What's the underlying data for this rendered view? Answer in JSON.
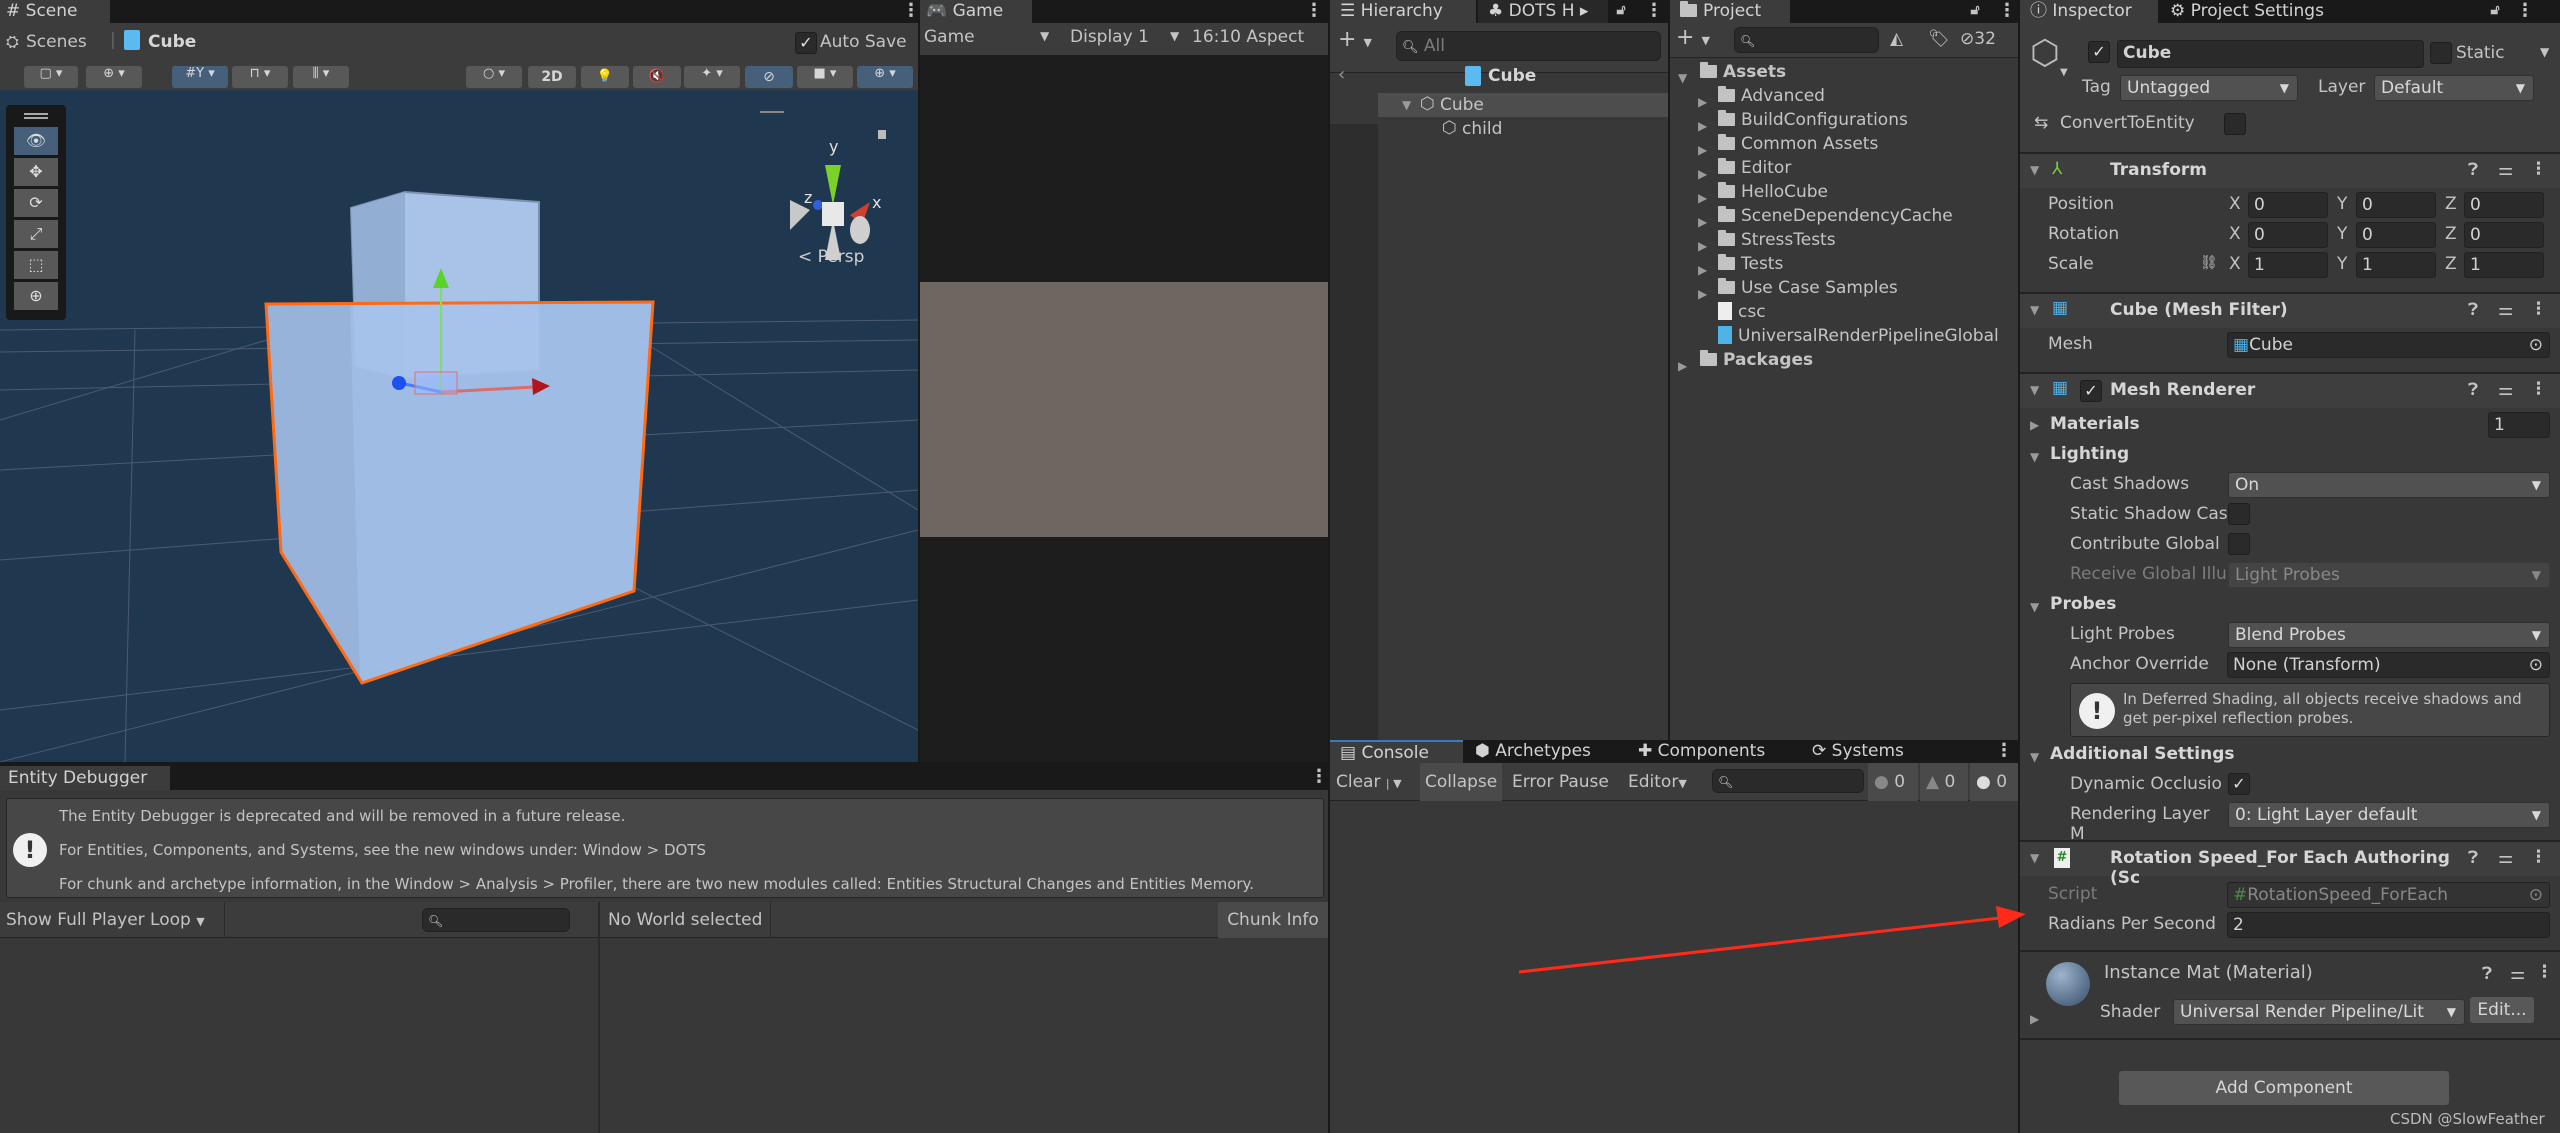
{
  "scene": {
    "tab": "Scene",
    "breadcrumb": [
      "Scenes",
      "Cube"
    ],
    "auto_save_label": "Auto Save",
    "auto_save_checked": true,
    "btn_2d": "2D",
    "persp_label": "Persp",
    "gizmo_axes": [
      "y",
      "z",
      "x"
    ],
    "tools": [
      "view-tool-icon",
      "move-tool-icon",
      "rotate-tool-icon",
      "scale-tool-icon",
      "rect-tool-icon",
      "transform-tool-icon"
    ],
    "sky_color": "#203750",
    "selection_color": "#ff6a13"
  },
  "game": {
    "tab": "Game",
    "mode": "Game",
    "display": "Display 1",
    "aspect": "16:10 Aspect",
    "viewport_color": "#6e6660"
  },
  "hierarchy": {
    "tabs": [
      "Hierarchy",
      "DOTS H"
    ],
    "search_placeholder": "All",
    "breadcrumb": "Cube",
    "items": [
      {
        "label": "Cube",
        "expanded": true,
        "selected": true
      },
      {
        "label": "child"
      }
    ]
  },
  "project": {
    "tab": "Project",
    "hidden_count": "32",
    "assets_label": "Assets",
    "folders": [
      "Advanced",
      "BuildConfigurations",
      "Common Assets",
      "Editor",
      "HelloCube",
      "SceneDependencyCache",
      "StressTests",
      "Tests",
      "Use Case Samples"
    ],
    "files": [
      "csc",
      "UniversalRenderPipelineGlobal"
    ],
    "packages_label": "Packages"
  },
  "inspector": {
    "tabs": [
      "Inspector",
      "Project Settings"
    ],
    "object_name": "Cube",
    "active": true,
    "static_label": "Static",
    "tag_label": "Tag",
    "tag_value": "Untagged",
    "layer_label": "Layer",
    "layer_value": "Default",
    "convert_label": "ConvertToEntity",
    "transform": {
      "title": "Transform",
      "rows": [
        {
          "label": "Position",
          "x": "0",
          "y": "0",
          "z": "0"
        },
        {
          "label": "Rotation",
          "x": "0",
          "y": "0",
          "z": "0"
        },
        {
          "label": "Scale",
          "x": "1",
          "y": "1",
          "z": "1"
        }
      ],
      "axes": [
        "X",
        "Y",
        "Z"
      ]
    },
    "mesh_filter": {
      "title": "Cube (Mesh Filter)",
      "mesh_label": "Mesh",
      "mesh_value": "Cube"
    },
    "mesh_renderer": {
      "title": "Mesh Renderer",
      "materials_label": "Materials",
      "materials_count": "1",
      "lighting_label": "Lighting",
      "cast_shadows_label": "Cast Shadows",
      "cast_shadows_value": "On",
      "static_shadow_label": "Static Shadow Cas",
      "contribute_gi_label": "Contribute Global",
      "receive_gi_label": "Receive Global Illu",
      "receive_gi_value": "Light Probes",
      "probes_label": "Probes",
      "light_probes_label": "Light Probes",
      "light_probes_value": "Blend Probes",
      "anchor_label": "Anchor Override",
      "anchor_value": "None (Transform)",
      "help_text": "In Deferred Shading, all objects receive shadows and get per-pixel reflection probes.",
      "additional_label": "Additional Settings",
      "dynamic_occlusion_label": "Dynamic Occlusio",
      "dynamic_occlusion_checked": true,
      "rendering_layer_label": "Rendering Layer M",
      "rendering_layer_value": "0: Light Layer default"
    },
    "rotation_speed": {
      "title": "Rotation Speed_For Each Authoring (Sc",
      "script_label": "Script",
      "script_value": "RotationSpeed_ForEach",
      "radians_label": "Radians Per Second",
      "radians_value": "2"
    },
    "material": {
      "title": "Instance Mat (Material)",
      "shader_label": "Shader",
      "shader_value": "Universal Render Pipeline/Lit",
      "edit_label": "Edit..."
    },
    "add_component": "Add Component"
  },
  "console": {
    "tabs": [
      "Console",
      "Archetypes",
      "Components",
      "Systems"
    ],
    "clear": "Clear",
    "collapse": "Collapse",
    "error_pause": "Error Pause",
    "editor": "Editor",
    "log_count": "0",
    "warn_count": "0",
    "error_count": "0"
  },
  "entity_debugger": {
    "tab": "Entity Debugger",
    "messages": [
      "The Entity Debugger is deprecated and will be removed in a future release.",
      "For Entities, Components, and Systems, see the new windows under: Window > DOTS",
      "For chunk and archetype information, in the Window > Analysis > Profiler, there are two new modules called: Entities Structural Changes and Entities Memory."
    ],
    "player_loop": "Show Full Player Loop",
    "world": "No World selected",
    "chunk_info": "Chunk Info"
  },
  "watermark": "CSDN @SlowFeather",
  "annotation_arrow_color": "#ff2a1a"
}
